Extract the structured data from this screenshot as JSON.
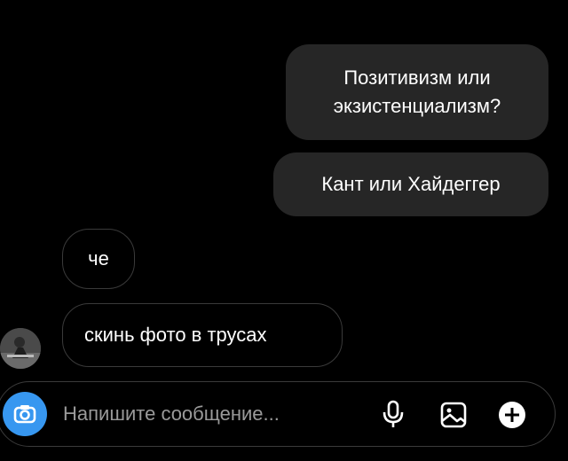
{
  "messages": {
    "sent_1": "Позитивизм или\nэкзистенциализм?",
    "sent_2": "Кант или Хайдеггер",
    "received_1": "че",
    "received_2": "скинь фото в трусах"
  },
  "composer": {
    "placeholder": "Напишите сообщение...",
    "camera_icon": "camera-icon",
    "mic_icon": "microphone-icon",
    "gallery_icon": "image-gallery-icon",
    "plus_icon": "plus-circle-icon"
  },
  "colors": {
    "background": "#000000",
    "sent_bubble": "#262626",
    "received_border": "#3a3a3a",
    "camera_accent": "#3797f0",
    "placeholder_text": "#9a9a9a"
  }
}
